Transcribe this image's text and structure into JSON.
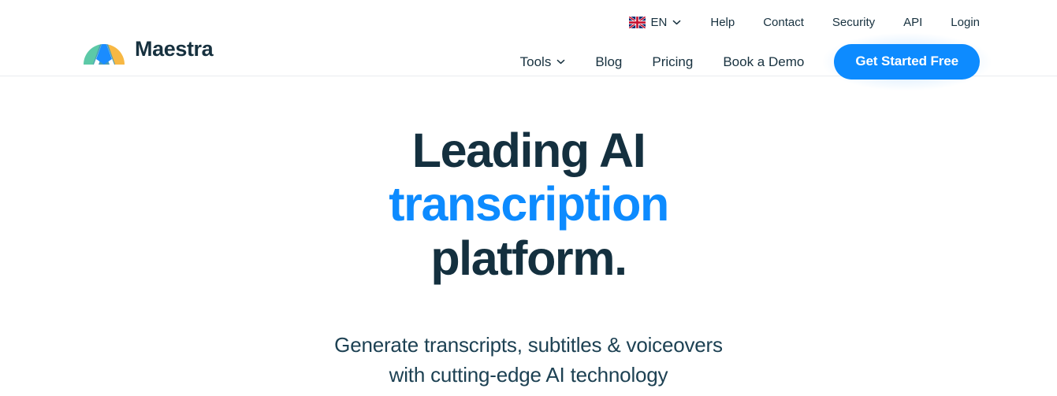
{
  "brand": {
    "name": "Maestra",
    "logo_icon": "maestra-dome-logo",
    "logo_colors": {
      "left_green": "#5cc9a7",
      "mid_teal": "#4a9cb5",
      "center_blue": "#1a8cff",
      "right_orange": "#f7b844"
    }
  },
  "header": {
    "utility_nav": {
      "language": {
        "flag_icon": "uk-flag-icon",
        "code": "EN",
        "chevron_icon": "chevron-down-icon"
      },
      "links": [
        {
          "label": "Help"
        },
        {
          "label": "Contact"
        },
        {
          "label": "Security"
        },
        {
          "label": "API"
        },
        {
          "label": "Login"
        }
      ]
    },
    "main_nav": {
      "links": [
        {
          "label": "Tools",
          "has_dropdown": true,
          "chevron_icon": "chevron-down-icon"
        },
        {
          "label": "Blog",
          "has_dropdown": false
        },
        {
          "label": "Pricing",
          "has_dropdown": false
        },
        {
          "label": "Book a Demo",
          "has_dropdown": false
        }
      ],
      "cta": {
        "label": "Get Started Free",
        "bg_color": "#0d8bff",
        "text_color": "#ffffff"
      }
    }
  },
  "hero": {
    "title_line1": "Leading AI",
    "title_line2": "transcription",
    "title_line3": "platform.",
    "accent_color": "#0d8bff",
    "title_color": "#14303f",
    "subtitle_line1": "Generate transcripts, subtitles & voiceovers",
    "subtitle_line2": "with cutting-edge AI technology"
  }
}
